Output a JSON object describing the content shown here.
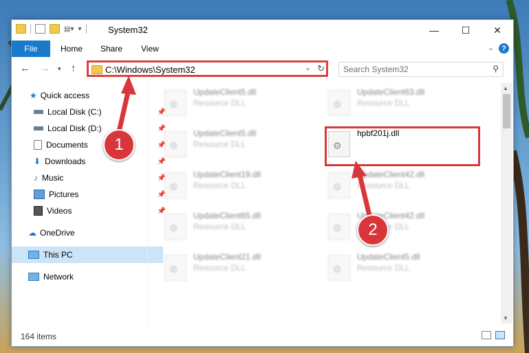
{
  "window": {
    "title": "System32",
    "minimize_icon": "minimize-icon",
    "maximize_icon": "maximize-icon",
    "close_icon": "close-icon"
  },
  "ribbon": {
    "tabs": [
      "File",
      "Home",
      "Share",
      "View"
    ],
    "help_label": "?"
  },
  "address": {
    "path": "C:\\Windows\\System32",
    "search_placeholder": "Search System32"
  },
  "nav": {
    "quick_access": "Quick access",
    "items": [
      {
        "label": "Local Disk (C:)",
        "icon": "drive-icon",
        "pinned": true
      },
      {
        "label": "Local Disk (D:)",
        "icon": "drive-icon",
        "pinned": true
      },
      {
        "label": "Documents",
        "icon": "documents-icon",
        "pinned": true
      },
      {
        "label": "Downloads",
        "icon": "downloads-icon",
        "pinned": true
      },
      {
        "label": "Music",
        "icon": "music-icon",
        "pinned": true
      },
      {
        "label": "Pictures",
        "icon": "pictures-icon",
        "pinned": true
      },
      {
        "label": "Videos",
        "icon": "videos-icon",
        "pinned": true
      }
    ],
    "onedrive": "OneDrive",
    "this_pc": "This PC",
    "network": "Network"
  },
  "files": {
    "left": [
      {
        "name": "UpdateClient5.dll",
        "desc": "Resource DLL"
      },
      {
        "name": "UpdateClient5.dll",
        "desc": "Resource DLL"
      },
      {
        "name": "UpdateClient19.dll",
        "desc": "Resource DLL"
      },
      {
        "name": "UpdateClient65.dll",
        "desc": "Resource DLL"
      },
      {
        "name": "UpdateClient21.dll",
        "desc": "Resource DLL"
      }
    ],
    "right": [
      {
        "name": "UpdateClient63.dll",
        "desc": "Resource DLL"
      },
      {
        "name": "hpbf201j.dll",
        "desc": ""
      },
      {
        "name": "UpdateClient42.dll",
        "desc": "Resource DLL"
      },
      {
        "name": "UpdateClient42.dll",
        "desc": "Resource DLL"
      },
      {
        "name": "UpdateClient5.dll",
        "desc": "Resource DLL"
      }
    ]
  },
  "status": {
    "count": "164 items"
  },
  "annotations": {
    "step1": "1",
    "step2": "2",
    "accent": "#d8363a"
  }
}
